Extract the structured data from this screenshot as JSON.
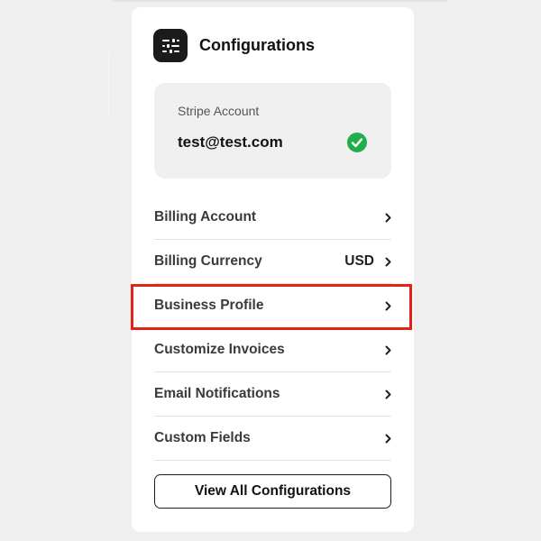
{
  "header": {
    "title": "Configurations",
    "icon": "settings-sliders-icon"
  },
  "stripe": {
    "label": "Stripe Account",
    "email": "test@test.com",
    "status_icon": "check-circle-icon",
    "status_color": "#1fae4b"
  },
  "menu": {
    "items": [
      {
        "label": "Billing Account",
        "value": ""
      },
      {
        "label": "Billing Currency",
        "value": "USD"
      },
      {
        "label": "Business Profile",
        "value": "",
        "highlighted": true
      },
      {
        "label": "Customize Invoices",
        "value": ""
      },
      {
        "label": "Email Notifications",
        "value": ""
      },
      {
        "label": "Custom Fields",
        "value": ""
      }
    ]
  },
  "footer": {
    "button_label": "View All Configurations"
  },
  "colors": {
    "highlight": "#e2231a",
    "icon_bg": "#1b1b1b"
  }
}
